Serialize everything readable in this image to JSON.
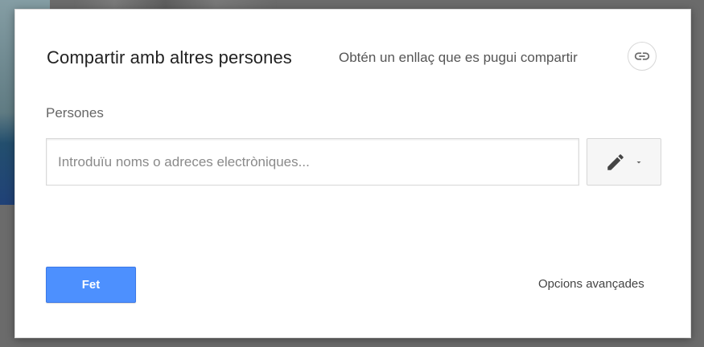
{
  "dialog": {
    "title": "Compartir amb altres persones",
    "get_link_text": "Obtén un enllaç que es pugui compartir",
    "people_label": "Persones",
    "people_input": {
      "value": "",
      "placeholder": "Introduïu noms o adreces electròniques..."
    },
    "permission_icon": "pencil-icon",
    "permission_dropdown_icon": "chevron-down-icon",
    "done_button_label": "Fet",
    "advanced_options_label": "Opcions avançades"
  },
  "colors": {
    "primary": "#4d90fe",
    "primary_border": "#3b78e7",
    "text_primary": "#222222",
    "text_secondary": "#555555",
    "overlay": "#6b6b6b",
    "dialog_bg": "#ffffff"
  },
  "icons": {
    "link": "link-icon",
    "pencil": "pencil-icon",
    "chevron_down": "chevron-down-icon"
  }
}
